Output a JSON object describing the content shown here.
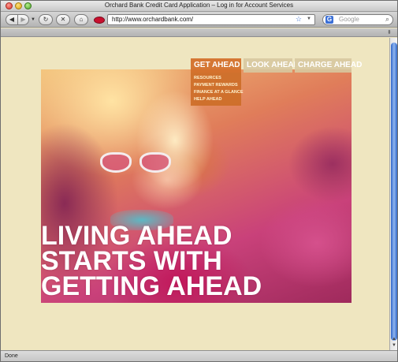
{
  "window": {
    "title": "Orchard Bank Credit Card Application – Log in for Account Services"
  },
  "toolbar": {
    "back_icon": "◀",
    "forward_icon": "▶",
    "reload_icon": "↻",
    "stop_icon": "✕",
    "home_icon": "⌂",
    "url": "http://www.orchardbank.com/",
    "search_placeholder": "Google",
    "search_engine_letter": "G"
  },
  "site": {
    "nav": {
      "get_ahead": "GET AHEAD",
      "look_ahead": "LOOK AHEAD",
      "charge_ahead": "CHARGE AHEAD"
    },
    "dropdown": [
      "RESOURCES",
      "PAYMENT REWARDS",
      "FINANCE AT A GLANCE",
      "HELP AHEAD"
    ],
    "headline": [
      "LIVING AHEAD",
      "STARTS WITH",
      "GETTING AHEAD"
    ]
  },
  "status": {
    "text": "Done"
  },
  "colors": {
    "page_background": "#efe6c0",
    "nav_active": "#d26e28",
    "nav_inactive": "#d7c8a0",
    "headline": "#ffffff",
    "scroll_thumb": "#2f67c9"
  },
  "icons": [
    "back-arrow-icon",
    "forward-arrow-icon",
    "reload-icon",
    "stop-icon",
    "home-icon",
    "site-favicon",
    "bookmark-star-icon",
    "google-icon",
    "magnifier-icon"
  ]
}
